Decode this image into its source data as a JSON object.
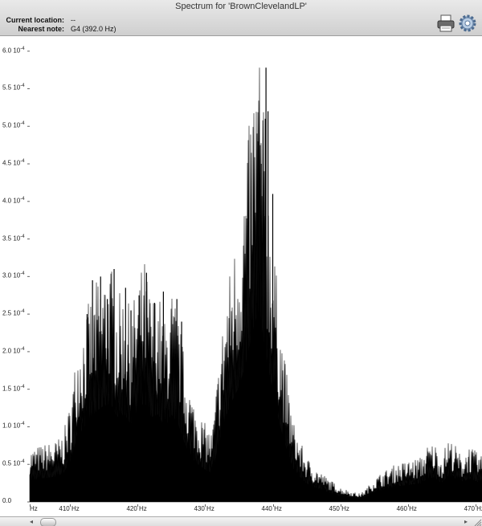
{
  "window": {
    "title": "Spectrum for 'BrownClevelandLP'"
  },
  "info": {
    "current_location_label": "Current location:",
    "current_location_value": "--",
    "nearest_note_label": "Nearest note:",
    "nearest_note_value": "G4 (392.0 Hz)"
  },
  "toolbar": {
    "print_icon": "print-icon",
    "settings_icon": "gear-icon"
  },
  "scrollbar": {
    "left_arrow": "◂",
    "right_arrow": "▸"
  },
  "chart_data": {
    "type": "area",
    "x_unit": "Hz",
    "y_unit": "10⁻⁴",
    "xlim": [
      404,
      471
    ],
    "ylim": [
      0,
      6.2
    ],
    "x_ticks": [
      {
        "value": 404,
        "label": "Hz"
      },
      {
        "value": 410,
        "label": "410 Hz"
      },
      {
        "value": 420,
        "label": "420 Hz"
      },
      {
        "value": 430,
        "label": "430 Hz"
      },
      {
        "value": 440,
        "label": "440 Hz"
      },
      {
        "value": 450,
        "label": "450 Hz"
      },
      {
        "value": 460,
        "label": "460 Hz"
      },
      {
        "value": 470,
        "label": "470 Hz"
      }
    ],
    "y_ticks": [
      {
        "value": 0.0,
        "label": "0.0"
      },
      {
        "value": 0.5,
        "label": "0.5 10",
        "exp": "-4"
      },
      {
        "value": 1.0,
        "label": "1.0 10",
        "exp": "-4"
      },
      {
        "value": 1.5,
        "label": "1.5 10",
        "exp": "-4"
      },
      {
        "value": 2.0,
        "label": "2.0 10",
        "exp": "-4"
      },
      {
        "value": 2.5,
        "label": "2.5 10",
        "exp": "-4"
      },
      {
        "value": 3.0,
        "label": "3.0 10",
        "exp": "-4"
      },
      {
        "value": 3.5,
        "label": "3.5 10",
        "exp": "-4"
      },
      {
        "value": 4.0,
        "label": "4.0 10",
        "exp": "-4"
      },
      {
        "value": 4.5,
        "label": "4.5 10",
        "exp": "-4"
      },
      {
        "value": 5.0,
        "label": "5.0 10",
        "exp": "-4"
      },
      {
        "value": 5.5,
        "label": "5.5 10",
        "exp": "-4"
      },
      {
        "value": 6.0,
        "label": "6.0 10",
        "exp": "-4"
      }
    ],
    "envelope": {
      "x": [
        404,
        406,
        408,
        409,
        410,
        411,
        412,
        413,
        414,
        415,
        416,
        417,
        418,
        419,
        420,
        421,
        422,
        423,
        424,
        425,
        426,
        427,
        428,
        429,
        430,
        431,
        432,
        433,
        434,
        435,
        436,
        437,
        438,
        439,
        440,
        441,
        442,
        443,
        444,
        445,
        446,
        448,
        450,
        452,
        453,
        454,
        455,
        456,
        457,
        458,
        460,
        462,
        463,
        464,
        465,
        466,
        467,
        468,
        469,
        470,
        471
      ],
      "y": [
        0.65,
        0.7,
        0.75,
        0.85,
        1.2,
        1.9,
        2.2,
        2.5,
        2.7,
        2.85,
        2.9,
        2.5,
        2.6,
        2.3,
        2.7,
        2.95,
        2.5,
        2.6,
        2.2,
        2.6,
        2.3,
        1.7,
        1.3,
        1.1,
        0.95,
        0.85,
        1.7,
        2.5,
        3.0,
        3.4,
        4.1,
        5.05,
        5.75,
        4.2,
        3.3,
        2.3,
        1.6,
        1.0,
        0.75,
        0.55,
        0.45,
        0.3,
        0.18,
        0.12,
        0.1,
        0.18,
        0.28,
        0.35,
        0.4,
        0.45,
        0.5,
        0.55,
        0.7,
        0.72,
        0.55,
        0.78,
        0.7,
        0.55,
        0.7,
        0.62,
        0.55
      ]
    },
    "peaks": [
      {
        "x": 439.0,
        "y": 5.78
      },
      {
        "x": 438.9,
        "y": 5.1
      },
      {
        "x": 439.3,
        "y": 5.2
      },
      {
        "x": 438.3,
        "y": 4.5
      },
      {
        "x": 437.8,
        "y": 4.8
      },
      {
        "x": 440.0,
        "y": 4.1
      },
      {
        "x": 416.5,
        "y": 3.1
      },
      {
        "x": 414.5,
        "y": 3.0
      },
      {
        "x": 421.3,
        "y": 3.05
      },
      {
        "x": 413.3,
        "y": 2.95
      },
      {
        "x": 418.2,
        "y": 2.85
      },
      {
        "x": 420.2,
        "y": 2.75
      },
      {
        "x": 423.8,
        "y": 2.8
      },
      {
        "x": 425.8,
        "y": 2.7
      },
      {
        "x": 415.5,
        "y": 2.7
      },
      {
        "x": 422.5,
        "y": 2.65
      },
      {
        "x": 412.5,
        "y": 2.5
      },
      {
        "x": 419.0,
        "y": 2.55
      },
      {
        "x": 426.5,
        "y": 2.4
      }
    ]
  }
}
